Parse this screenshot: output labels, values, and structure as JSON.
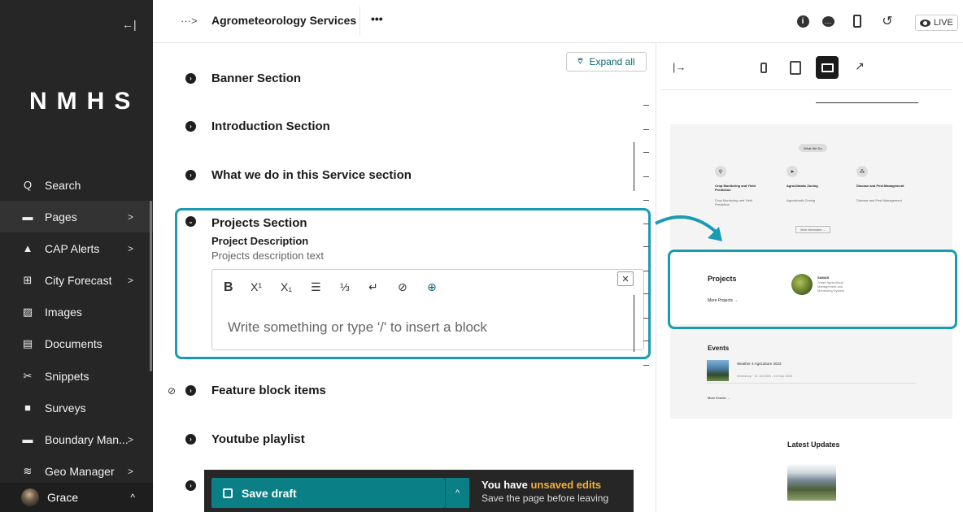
{
  "sidebar": {
    "collapse_icon": "←|",
    "logo": "NMHS",
    "items": [
      {
        "label": "Search",
        "icon": "Q"
      },
      {
        "label": "Pages",
        "icon": "▬",
        "chevron": ">"
      },
      {
        "label": "CAP Alerts",
        "icon": "▲",
        "chevron": ">"
      },
      {
        "label": "City Forecast",
        "icon": "⊞",
        "chevron": ">"
      },
      {
        "label": "Images",
        "icon": "▨"
      },
      {
        "label": "Documents",
        "icon": "▤"
      },
      {
        "label": "Snippets",
        "icon": "✂"
      },
      {
        "label": "Surveys",
        "icon": "■"
      },
      {
        "label": "Boundary Man...",
        "icon": "▬",
        "chevron": ">"
      },
      {
        "label": "Geo Manager",
        "icon": "≋",
        "chevron": ">"
      }
    ],
    "user": {
      "name": "Grace",
      "chevron": "^"
    }
  },
  "topbar": {
    "breadcrumb_arrow": "···>",
    "title": "Agrometeorology Services",
    "more": "•••",
    "live_label": "LIVE"
  },
  "editor": {
    "expand_all": "Expand all",
    "sections": [
      "Banner Section",
      "Introduction Section",
      "What we do in this Service section",
      "Projects Section",
      "Feature block items",
      "Youtube playlist"
    ],
    "projects": {
      "field_label": "Project Description",
      "help_text": "Projects description text",
      "toolbar": [
        "B",
        "X¹",
        "X₁",
        "☰",
        "⅓",
        "↵",
        "⊘",
        "⊕"
      ],
      "placeholder": "Write something or type '/' to insert a block"
    }
  },
  "savebar": {
    "save_label": "Save draft",
    "more": "^",
    "notice_prefix": "You have ",
    "notice_highlight": "unsaved edits",
    "notice_sub": "Save the page before leaving"
  },
  "preview": {
    "collapse_icon": "|→",
    "what_we_do_pill": "What We Do",
    "services": [
      {
        "title": "Crop Monitoring and Yield Prediction",
        "desc": "Crop Monitoring and Yield Prediction"
      },
      {
        "title": "Agroclimatic Zoning",
        "desc": "Agroclimatic Zoning"
      },
      {
        "title": "Disease and Pest Management",
        "desc": "Disease and Pest Management"
      }
    ],
    "more_information": "More information →",
    "projects_title": "Projects",
    "more_projects": "More Projects →",
    "project_name": "SAMAS",
    "project_desc": "Smart Agricultural Management and Monitoring System",
    "events_title": "Events",
    "event_name": "Weather 4 Agriculture 2023",
    "event_meta": "Workshop · 11 Jul 2023 - 10 Sep 2023",
    "more_events": "More Events →",
    "latest_updates": "Latest Updates"
  },
  "colors": {
    "sidebar_bg": "#262626",
    "accent_teal": "#0a7f86",
    "highlight_blue": "#1a9bb4",
    "warning_orange": "#f2b03c"
  }
}
